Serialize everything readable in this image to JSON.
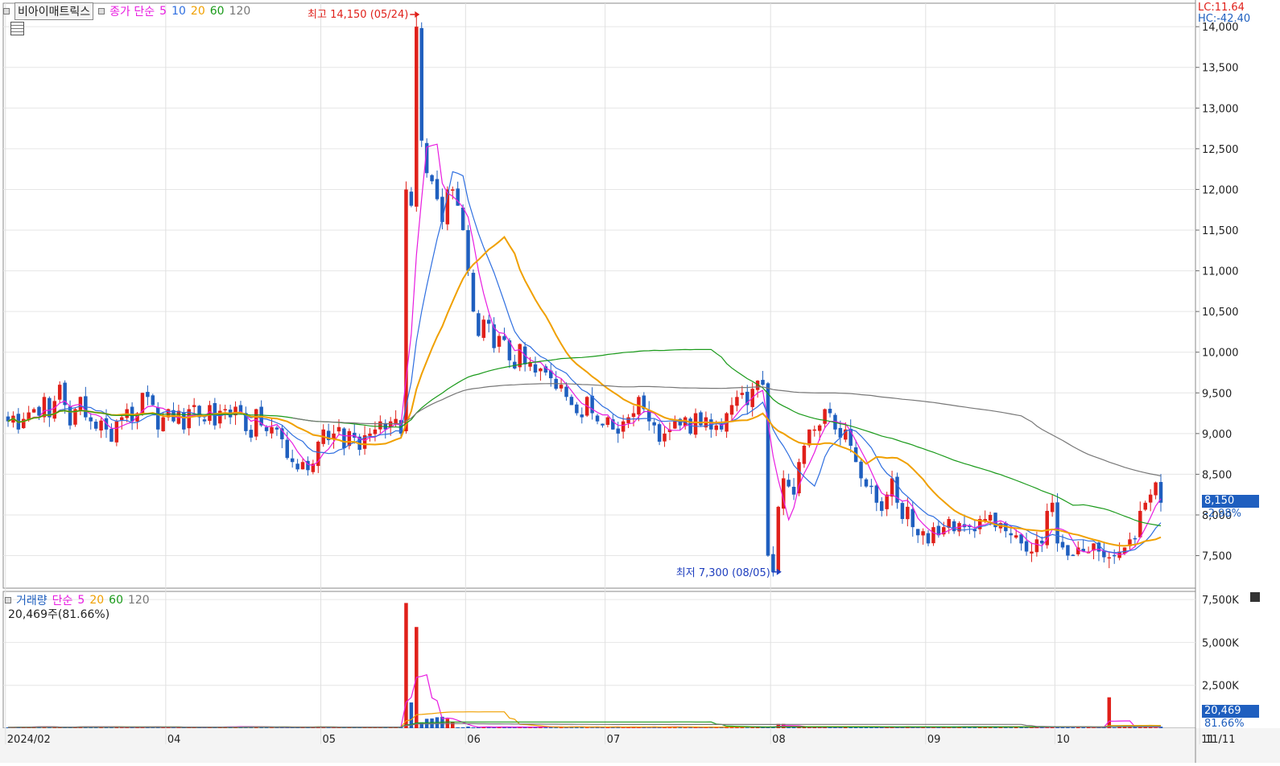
{
  "header": {
    "symbol": "비아이매트릭스",
    "ma_label": "종가 단순",
    "ma_periods": [
      "5",
      "10",
      "20",
      "60",
      "120"
    ],
    "ma_colors": [
      "#e81ce0",
      "#2f6fe0",
      "#f0a000",
      "#1a9a1a",
      "#777777"
    ],
    "grid_icon": "grid-icon"
  },
  "lc": "LC:11.64",
  "hc": "HC:-42.40",
  "annotations": {
    "high": "최고 14,150 (05/24)",
    "low": "최저 7,300 (08/05)"
  },
  "current": {
    "price": "8,150",
    "change": "-2.98%"
  },
  "volume_panel": {
    "label": "거래량",
    "ma_label": "단순",
    "ma_periods": [
      "5",
      "20",
      "60",
      "120"
    ],
    "ma_colors": [
      "#e81ce0",
      "#f0a000",
      "#1a9a1a",
      "#777777"
    ],
    "current": "20,469주(81.66%)",
    "box_value": "20,469",
    "box_pct": "81.66%"
  },
  "chart_data": {
    "type": "candlestick",
    "price_axis": {
      "ticks": [
        7500,
        8000,
        8500,
        9000,
        9500,
        10000,
        10500,
        11000,
        11500,
        12000,
        12500,
        13000,
        13500,
        14000
      ],
      "tick_labels": [
        "7,500",
        "8,000",
        "8,500",
        "9,000",
        "9,500",
        "10,000",
        "10,500",
        "11,000",
        "11,500",
        "12,000",
        "12,500",
        "13,000",
        "13,500",
        "14,000"
      ],
      "range": [
        7100,
        14150
      ]
    },
    "volume_axis": {
      "ticks": [
        2500,
        5000,
        7500
      ],
      "tick_labels": [
        "2,500K",
        "5,000K",
        "7,500K"
      ],
      "range": [
        0,
        7600
      ]
    },
    "x_labels": [
      {
        "label": "2024/02",
        "index": 0
      },
      {
        "label": "04",
        "index": 31
      },
      {
        "label": "05",
        "index": 61
      },
      {
        "label": "06",
        "index": 89
      },
      {
        "label": "07",
        "index": 116
      },
      {
        "label": "08",
        "index": 148
      },
      {
        "label": "09",
        "index": 178
      },
      {
        "label": "10",
        "index": 203
      },
      {
        "label": "11",
        "index": 231
      }
    ],
    "last_date_label": "11/11",
    "closes": [
      9150,
      9220,
      9050,
      9180,
      9260,
      9300,
      9220,
      9450,
      9200,
      9400,
      9600,
      9350,
      9100,
      9300,
      9450,
      9200,
      9150,
      9060,
      9160,
      9050,
      8900,
      9150,
      9200,
      9300,
      9150,
      9250,
      9500,
      9450,
      9350,
      9050,
      9200,
      9300,
      9150,
      9280,
      9050,
      9300,
      9350,
      9200,
      9150,
      9350,
      9100,
      9280,
      9300,
      9200,
      9330,
      9250,
      9030,
      8950,
      9300,
      9100,
      9030,
      9080,
      9050,
      8930,
      8700,
      8650,
      8560,
      8650,
      8550,
      8630,
      8900,
      9050,
      8920,
      9000,
      9080,
      8820,
      9030,
      8950,
      8800,
      8980,
      9000,
      9050,
      9150,
      9050,
      9150,
      9180,
      9000,
      12000,
      11800,
      14000,
      12600,
      12200,
      12100,
      11880,
      11600,
      12000,
      12000,
      11800,
      11500,
      11000,
      10500,
      10200,
      10400,
      10350,
      10050,
      10200,
      10150,
      9900,
      9800,
      10100,
      9850,
      9880,
      9750,
      9800,
      9750,
      9680,
      9550,
      9600,
      9450,
      9350,
      9250,
      9200,
      9450,
      9250,
      9150,
      9100,
      9200,
      9050,
      9000,
      9150,
      9200,
      9250,
      9450,
      9300,
      9150,
      9100,
      8900,
      9000,
      9050,
      9150,
      9100,
      9200,
      9000,
      9250,
      9100,
      9200,
      9050,
      9100,
      9050,
      9250,
      9350,
      9450,
      9500,
      9350,
      9550,
      9650,
      9600,
      7500,
      7300,
      8100,
      8450,
      8350,
      8250,
      8650,
      8850,
      9050,
      9050,
      9100,
      9300,
      9250,
      9050,
      8950,
      9050,
      8850,
      8650,
      8450,
      8350,
      8350,
      8150,
      8050,
      8250,
      8450,
      8150,
      7950,
      8100,
      7850,
      7750,
      7800,
      7650,
      7850,
      7750,
      7850,
      7950,
      7800,
      7900,
      7850,
      7850,
      7800,
      7950,
      7950,
      8000,
      7850,
      7900,
      7800,
      7750,
      7750,
      7650,
      7550,
      7550,
      7700,
      7650,
      8050,
      8150,
      7650,
      7600,
      7500,
      7500,
      7600,
      7550,
      7550,
      7650,
      7550,
      7480,
      7480,
      7500,
      7550,
      7600,
      7700,
      7700,
      8050,
      8150,
      8250,
      8400,
      8150
    ]
  }
}
